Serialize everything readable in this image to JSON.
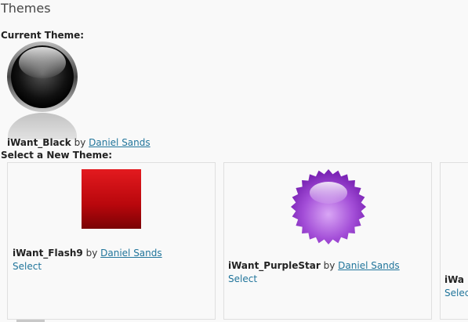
{
  "page": {
    "title": "Themes"
  },
  "current": {
    "label": "Current Theme:",
    "theme_name": "iWant_Black",
    "by": "by",
    "author": "Daniel Sands",
    "icon": "black-glossy-orb-icon"
  },
  "available": {
    "label": "Select a New Theme:",
    "themes": [
      {
        "name": "iWant_Flash9",
        "by": "by",
        "author": "Daniel Sands",
        "select": "Select",
        "icon": "red-square-icon",
        "color": "#c4060c"
      },
      {
        "name": "iWant_PurpleStar",
        "by": "by",
        "author": "Daniel Sands",
        "select": "Select",
        "icon": "purple-star-icon",
        "color": "#9b3fcf"
      },
      {
        "name": "iWa",
        "select": "Selec"
      }
    ]
  },
  "colors": {
    "link": "#21759b",
    "border": "#dfdfdf",
    "background": "#f9f9f9"
  }
}
